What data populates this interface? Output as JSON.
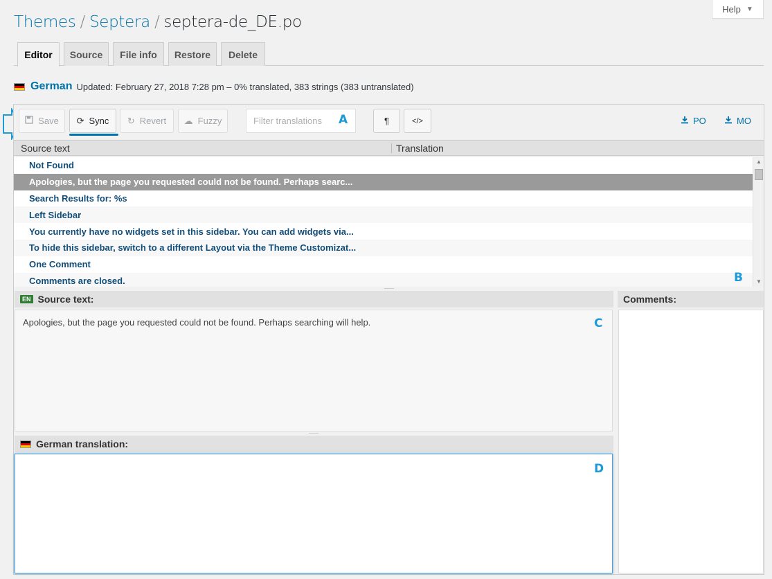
{
  "help": {
    "label": "Help"
  },
  "breadcrumb": {
    "themes": "Themes",
    "theme": "Septera",
    "file": "septera-de_DE.po",
    "separator": "/"
  },
  "tabs": [
    {
      "label": "Editor",
      "active": true
    },
    {
      "label": "Source",
      "active": false
    },
    {
      "label": "File info",
      "active": false
    },
    {
      "label": "Restore",
      "active": false
    },
    {
      "label": "Delete",
      "active": false
    }
  ],
  "status": {
    "language": "German",
    "text": "Updated: February 27, 2018 7:28 pm – 0% translated, 383 strings (383 untranslated)"
  },
  "toolbar": {
    "save_label": "Save",
    "sync_label": "Sync",
    "revert_label": "Revert",
    "fuzzy_label": "Fuzzy",
    "filter_placeholder": "Filter translations",
    "pilcrow": "¶",
    "code": "</>",
    "po_label": "PO",
    "mo_label": "MO"
  },
  "annotations": {
    "a": "A",
    "b": "B",
    "c": "C",
    "d": "D"
  },
  "list": {
    "col_source": "Source text",
    "col_translation": "Translation",
    "rows": [
      "Not Found",
      "Apologies, but the page you requested could not be found. Perhaps searc...",
      "Search Results for: %s",
      "Left Sidebar",
      "You currently have no widgets set in this sidebar. You can add widgets via...",
      "To hide this sidebar, switch to a different Layout via the Theme Customizat...",
      "One Comment",
      "Comments are closed."
    ],
    "selected_index": 1
  },
  "source_pane": {
    "badge": "EN",
    "heading": "Source text:",
    "text": "Apologies, but the page you requested could not be found. Perhaps searching will help."
  },
  "translation_pane": {
    "heading": "German translation:",
    "value": ""
  },
  "comments_pane": {
    "heading": "Comments:"
  },
  "colors": {
    "link": "#0073aa",
    "annotation": "#1e9ad6",
    "selected_row": "#9a9a9a"
  }
}
